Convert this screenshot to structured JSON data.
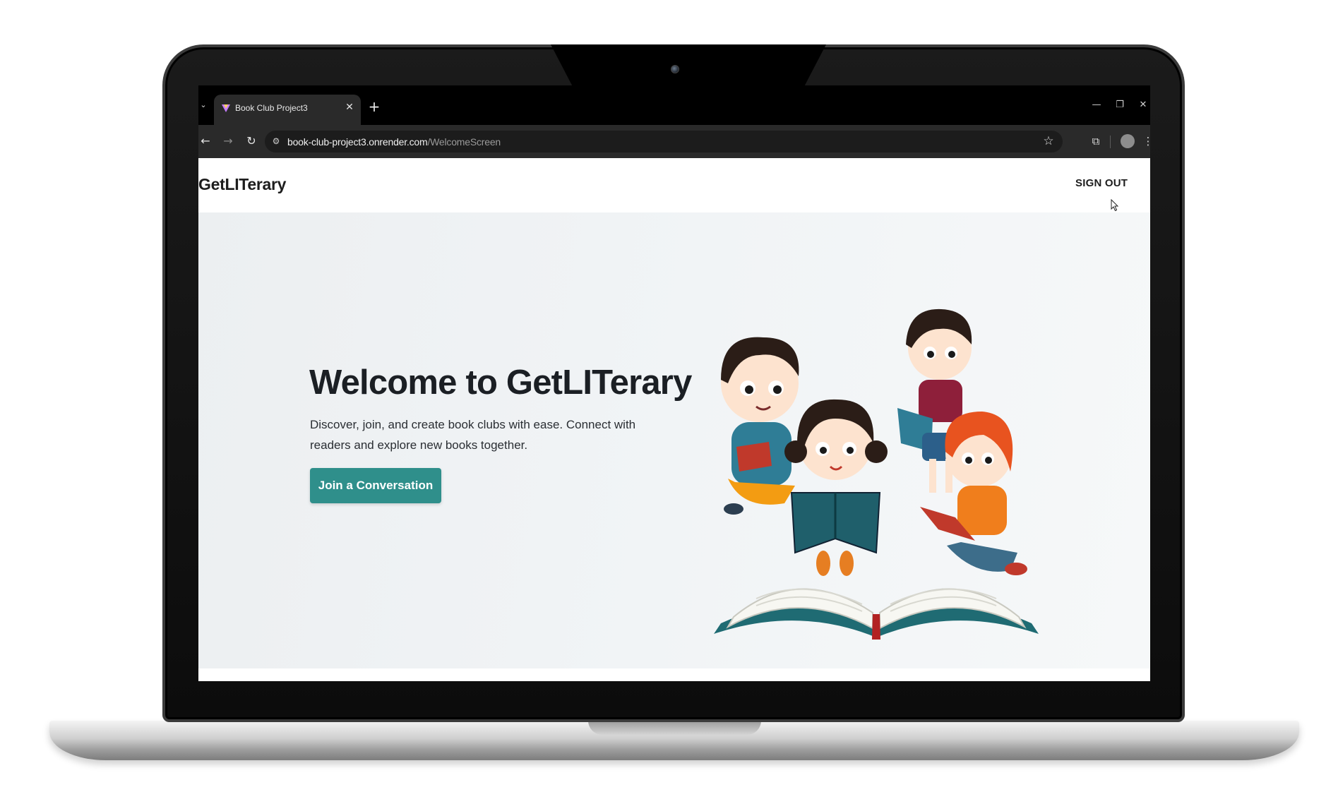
{
  "browser": {
    "tab": {
      "title": "Book Club Project3",
      "close_glyph": "✕"
    },
    "tab_search_glyph": "⌄",
    "new_tab_glyph": "+",
    "window_controls": {
      "minimize": "—",
      "restore": "❐",
      "close": "✕"
    },
    "nav": {
      "back": "←",
      "forward": "→",
      "reload": "↻"
    },
    "address_bar": {
      "site_info_glyph": "⚙",
      "host": "book-club-project3.onrender.com",
      "path": "/WelcomeScreen",
      "bookmark_glyph": "☆"
    },
    "extensions_glyph": "⧉",
    "menu_glyph": "⋮",
    "icons": [
      "tab-search-icon",
      "close-icon",
      "plus-icon",
      "minimize-icon",
      "restore-icon",
      "back-icon",
      "forward-icon",
      "reload-icon",
      "site-info-icon",
      "star-icon",
      "extensions-icon",
      "profile-icon",
      "menu-icon"
    ]
  },
  "navbar": {
    "brand": "GetLITerary",
    "sign_out": "SIGN OUT"
  },
  "hero": {
    "title": "Welcome to GetLITerary",
    "subtitle": "Discover, join, and create book clubs with ease. Connect with readers and explore new books together.",
    "cta_label": "Join a Conversation",
    "illustration": "children-reading-books-illustration"
  },
  "colors": {
    "accent": "#2f8f8b",
    "hero_bg": "#eef1f3",
    "chrome_dark": "#2a2a2a"
  }
}
